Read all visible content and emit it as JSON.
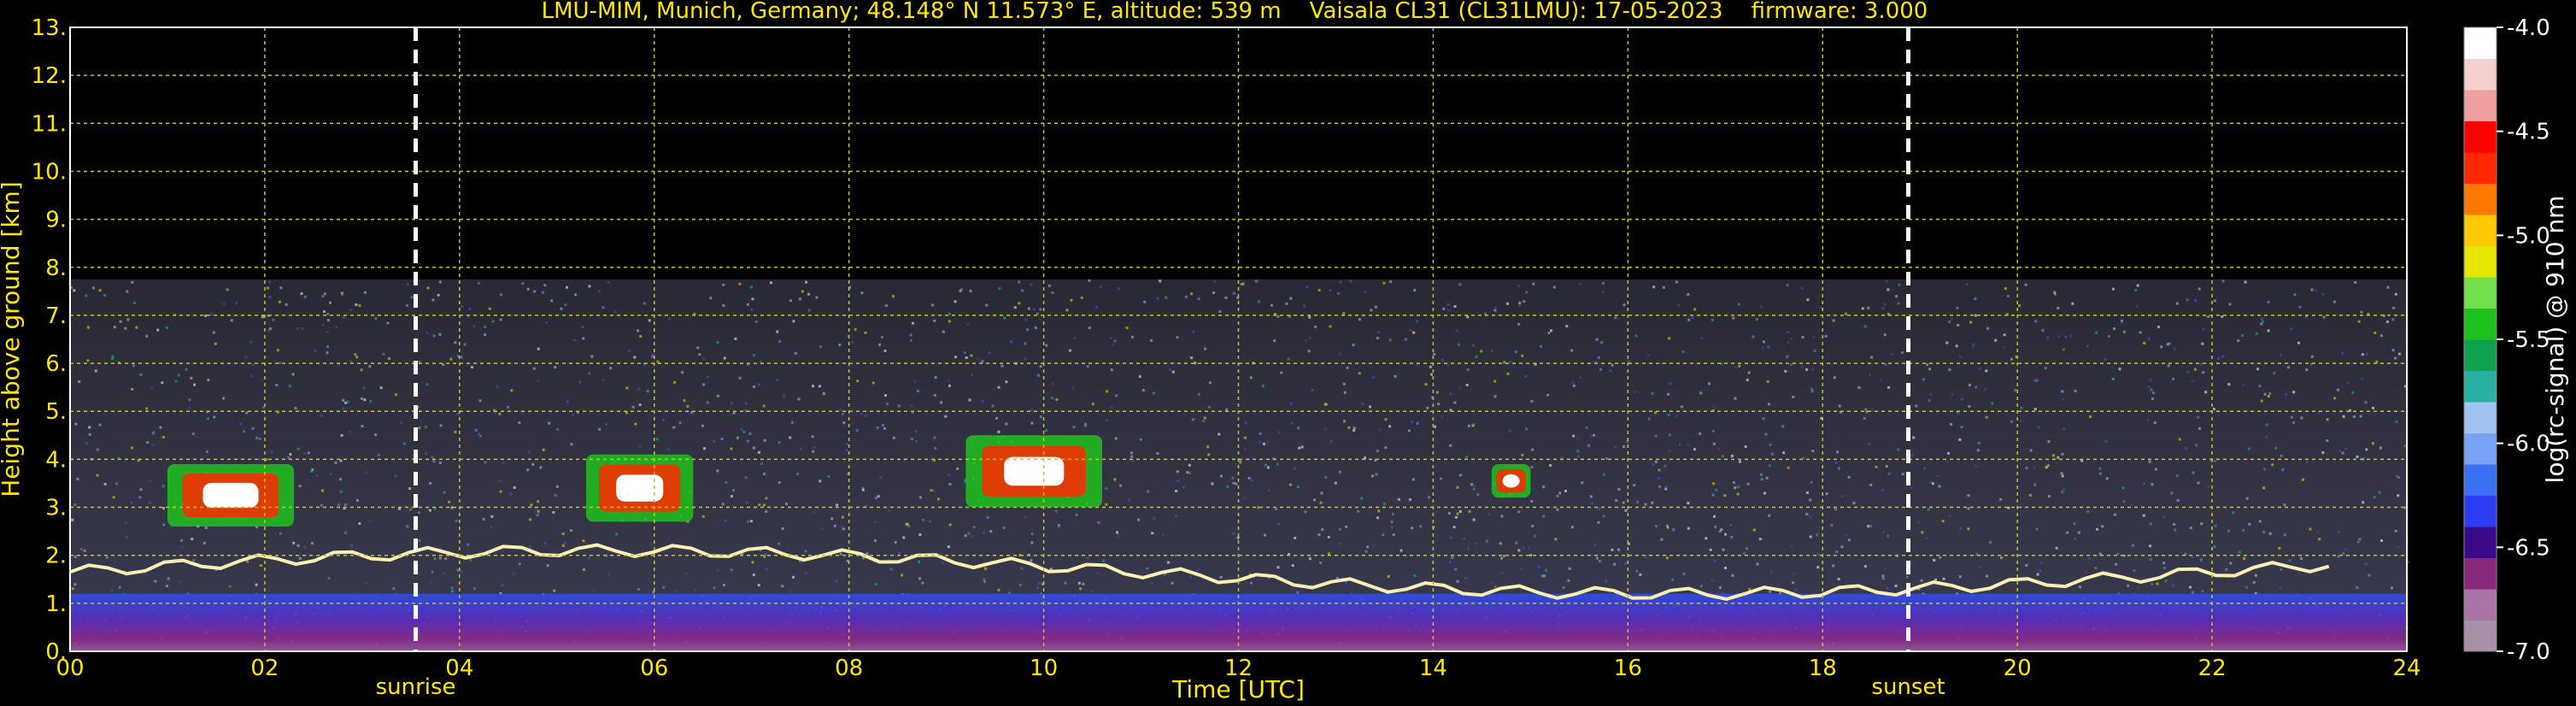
{
  "chart_data": {
    "type": "heatmap",
    "title": "LMU-MIM, Munich, Germany; 48.148° N 11.573° E, altitude: 539 m    Vaisala CL31 (CL31LMU): 17-05-2023    firmware: 3.000",
    "xlabel": "Time [UTC]",
    "ylabel": "Height above ground [km]",
    "xlim": [
      0,
      24
    ],
    "ylim": [
      0,
      13
    ],
    "x_ticks": [
      "00",
      "02",
      "04",
      "06",
      "08",
      "10",
      "12",
      "14",
      "16",
      "18",
      "20",
      "22",
      "24"
    ],
    "y_ticks": [
      "0.",
      "1.",
      "2.",
      "3.",
      "4.",
      "5.",
      "6.",
      "7.",
      "8.",
      "9.",
      "10.",
      "11.",
      "12.",
      "13."
    ],
    "grid": true,
    "markers": [
      {
        "label": "sunrise",
        "x": 3.55
      },
      {
        "label": "sunset",
        "x": 18.88
      }
    ],
    "data_max_height_km": 7.75,
    "colorbar": {
      "label": "log(rc-signal) @ 910 nm",
      "range": [
        -7.0,
        -4.0
      ],
      "ticks": [
        "-4.0",
        "-4.5",
        "-5.0",
        "-5.5",
        "-6.0",
        "-6.5",
        "-7.0"
      ],
      "colors": [
        "#a990a9",
        "#a874a3",
        "#8a2a7c",
        "#3a0a8a",
        "#2b3df2",
        "#3b72f5",
        "#7aa2f5",
        "#9ec4ef",
        "#28b0a0",
        "#0fa052",
        "#1ec21e",
        "#72e04a",
        "#e6e600",
        "#ffc800",
        "#ff7800",
        "#ff2800",
        "#ff0000",
        "#f0a0a0",
        "#f4d0d0",
        "#ffffff"
      ]
    },
    "features": [
      {
        "name": "cloud",
        "x": [
          1.0,
          2.3
        ],
        "y": [
          2.6,
          3.9
        ]
      },
      {
        "name": "cloud",
        "x": [
          5.3,
          6.4
        ],
        "y": [
          2.7,
          4.1
        ]
      },
      {
        "name": "cloud",
        "x": [
          9.2,
          10.6
        ],
        "y": [
          3.0,
          4.5
        ]
      },
      {
        "name": "cloud",
        "x": [
          14.6,
          15.0
        ],
        "y": [
          3.2,
          3.9
        ]
      },
      {
        "name": "boundary-layer-top",
        "x": [
          0,
          23.2
        ],
        "y": [
          1.2,
          2.1
        ]
      }
    ]
  }
}
